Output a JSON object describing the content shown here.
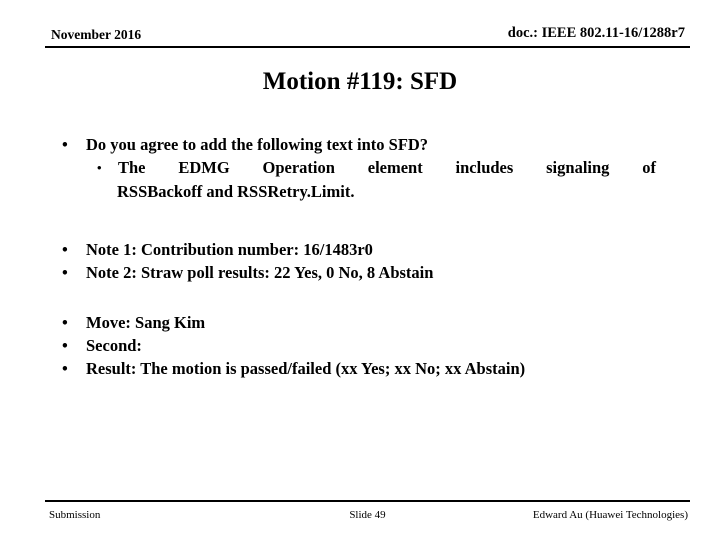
{
  "header": {
    "date": "November 2016",
    "doc": "doc.: IEEE 802.11-16/1288r7"
  },
  "title": "Motion #119:  SFD",
  "body": {
    "bullet_char": "•",
    "group1": {
      "question": "Do you agree to add the following text into SFD?",
      "sub_line1": "The EDMG Operation element includes signaling of",
      "sub_line2": "RSSBackoff and RSSRetry.Limit."
    },
    "group2": {
      "note1": "Note 1:  Contribution number:  16/1483r0",
      "note2": "Note 2:  Straw poll results:  22 Yes, 0 No, 8 Abstain"
    },
    "group3": {
      "move": "Move:  Sang Kim",
      "second": "Second:",
      "result": "Result:  The motion is passed/failed (xx Yes; xx No; xx Abstain)"
    }
  },
  "footer": {
    "left": "Submission",
    "center": "Slide 49",
    "right": "Edward Au (Huawei Technologies)"
  }
}
